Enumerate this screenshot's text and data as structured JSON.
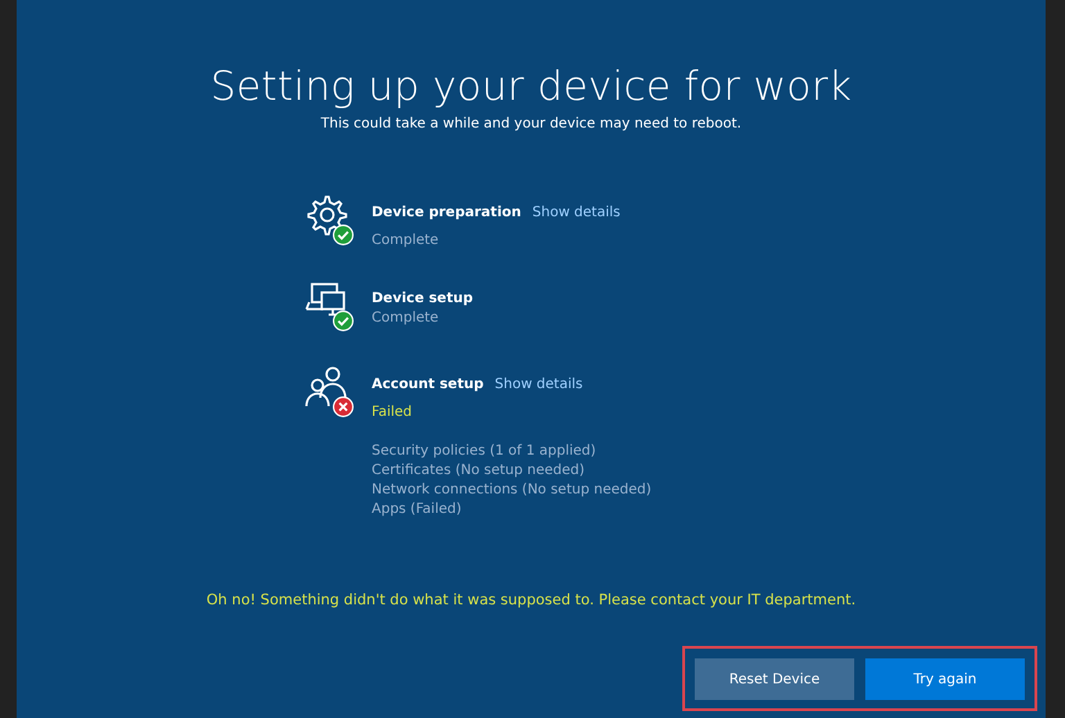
{
  "title": "Setting up your device for work",
  "subtitle": "This could take a while and your device may need to reboot.",
  "steps": [
    {
      "name": "Device preparation",
      "link": "Show details",
      "failed": false,
      "status_text": "Complete"
    },
    {
      "name": "Device setup",
      "failed": false,
      "status_text": "Complete"
    },
    {
      "name": "Account setup",
      "link": "Show details",
      "failed": true,
      "status_text": "Failed",
      "details": [
        "Security policies (1 of 1 applied)",
        "Certificates (No setup needed)",
        "Network connections (No setup needed)",
        "Apps (Failed)"
      ]
    }
  ],
  "error_message": "Oh no! Something didn't do what it was supposed to. Please contact your IT department.",
  "buttons": [
    {
      "label": "Reset Device",
      "kind": "secondary"
    },
    {
      "label": "Try again",
      "kind": "primary"
    }
  ],
  "buttons_highlighted": true
}
